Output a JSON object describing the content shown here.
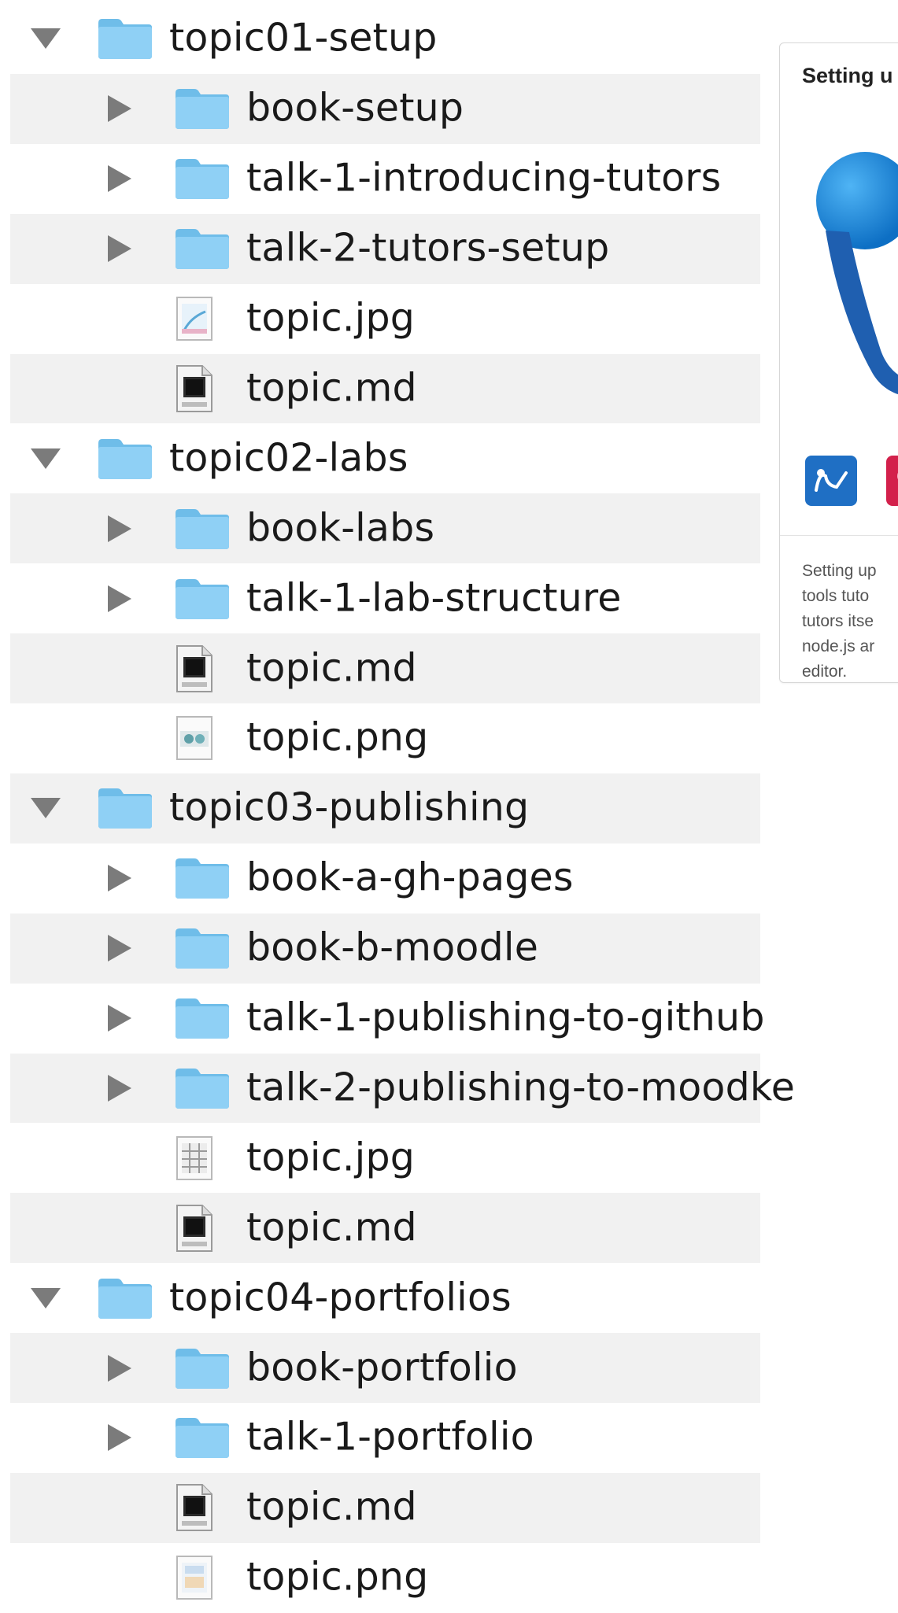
{
  "tree": [
    {
      "label": "topic01-setup",
      "kind": "folder",
      "level": 0,
      "expanded": true,
      "disclosure": "expanded-arrow-icon",
      "icon": "folder-icon"
    },
    {
      "label": "book-setup",
      "kind": "folder",
      "level": 1,
      "expanded": false,
      "disclosure": "collapsed-arrow-icon",
      "icon": "folder-icon"
    },
    {
      "label": "talk-1-introducing-tutors",
      "kind": "folder",
      "level": 1,
      "expanded": false,
      "disclosure": "collapsed-arrow-icon",
      "icon": "folder-icon"
    },
    {
      "label": "talk-2-tutors-setup",
      "kind": "folder",
      "level": 1,
      "expanded": false,
      "disclosure": "collapsed-arrow-icon",
      "icon": "folder-icon"
    },
    {
      "label": "topic.jpg",
      "kind": "image",
      "level": 1,
      "icon": "jpg-image-icon"
    },
    {
      "label": "topic.md",
      "kind": "markdown",
      "level": 1,
      "icon": "markdown-file-icon"
    },
    {
      "label": "topic02-labs",
      "kind": "folder",
      "level": 0,
      "expanded": true,
      "disclosure": "expanded-arrow-icon",
      "icon": "folder-icon"
    },
    {
      "label": "book-labs",
      "kind": "folder",
      "level": 1,
      "expanded": false,
      "disclosure": "collapsed-arrow-icon",
      "icon": "folder-icon"
    },
    {
      "label": "talk-1-lab-structure",
      "kind": "folder",
      "level": 1,
      "expanded": false,
      "disclosure": "collapsed-arrow-icon",
      "icon": "folder-icon"
    },
    {
      "label": "topic.md",
      "kind": "markdown",
      "level": 1,
      "icon": "markdown-file-icon"
    },
    {
      "label": "topic.png",
      "kind": "image",
      "level": 1,
      "icon": "png-image-icon"
    },
    {
      "label": "topic03-publishing",
      "kind": "folder",
      "level": 0,
      "expanded": true,
      "disclosure": "expanded-arrow-icon",
      "icon": "folder-icon"
    },
    {
      "label": "book-a-gh-pages",
      "kind": "folder",
      "level": 1,
      "expanded": false,
      "disclosure": "collapsed-arrow-icon",
      "icon": "folder-icon"
    },
    {
      "label": "book-b-moodle",
      "kind": "folder",
      "level": 1,
      "expanded": false,
      "disclosure": "collapsed-arrow-icon",
      "icon": "folder-icon"
    },
    {
      "label": "talk-1-publishing-to-github",
      "kind": "folder",
      "level": 1,
      "expanded": false,
      "disclosure": "collapsed-arrow-icon",
      "icon": "folder-icon"
    },
    {
      "label": "talk-2-publishing-to-moodke",
      "kind": "folder",
      "level": 1,
      "expanded": false,
      "disclosure": "collapsed-arrow-icon",
      "icon": "folder-icon"
    },
    {
      "label": "topic.jpg",
      "kind": "image",
      "level": 1,
      "icon": "jpg-image-icon"
    },
    {
      "label": "topic.md",
      "kind": "markdown",
      "level": 1,
      "icon": "markdown-file-icon"
    },
    {
      "label": "topic04-portfolios",
      "kind": "folder",
      "level": 0,
      "expanded": true,
      "disclosure": "expanded-arrow-icon",
      "icon": "folder-icon"
    },
    {
      "label": "book-portfolio",
      "kind": "folder",
      "level": 1,
      "expanded": false,
      "disclosure": "collapsed-arrow-icon",
      "icon": "folder-icon"
    },
    {
      "label": "talk-1-portfolio",
      "kind": "folder",
      "level": 1,
      "expanded": false,
      "disclosure": "collapsed-arrow-icon",
      "icon": "folder-icon"
    },
    {
      "label": "topic.md",
      "kind": "markdown",
      "level": 1,
      "icon": "markdown-file-icon"
    },
    {
      "label": "topic.png",
      "kind": "image",
      "level": 1,
      "icon": "png-image-icon"
    }
  ],
  "preview_card": {
    "title": "Setting u",
    "art_icon": "tutors-logo-icon",
    "badges": [
      "tutors-badge-icon",
      "red-badge-icon"
    ],
    "description_lines": [
      "Setting up",
      "tools tuto",
      "tutors itse",
      "node.js ar",
      "editor."
    ]
  },
  "colors": {
    "row_stripe": "#f1f1f1",
    "disclosure": "#7b7b7b",
    "folder_body": "#8fd0f5",
    "folder_tab": "#6fbde9",
    "text": "#1a1a1a",
    "logo_blue": "#1f7fd4"
  }
}
